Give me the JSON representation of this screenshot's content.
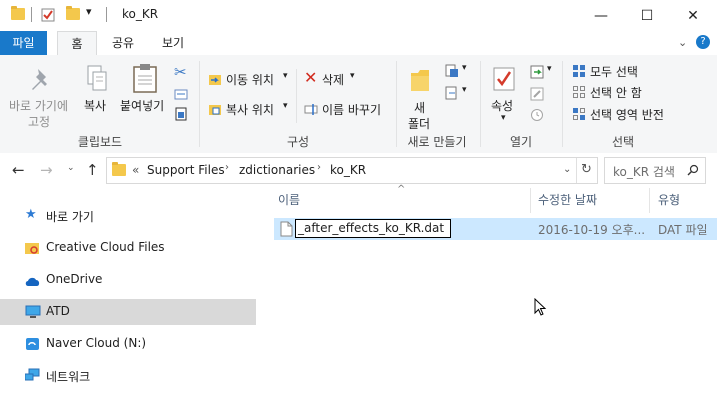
{
  "window": {
    "title": "ko_KR",
    "controls": {
      "minimize": "—",
      "maximize": "☐",
      "close": "✕"
    }
  },
  "ribbon_tabs": {
    "file": "파일",
    "home": "홈",
    "share": "공유",
    "view": "보기"
  },
  "ribbon": {
    "clipboard": {
      "pin_line1": "바로 가기에",
      "pin_line2": "고정",
      "copy": "복사",
      "paste": "붙여넣기",
      "group_label": "클립보드"
    },
    "organize": {
      "move_to": "이동 위치",
      "copy_to": "복사 위치",
      "delete": "삭제",
      "rename": "이름 바꾸기",
      "group_label": "구성"
    },
    "new": {
      "new_folder_line1": "새",
      "new_folder_line2": "폴더",
      "group_label": "새로 만들기"
    },
    "open": {
      "properties": "속성",
      "group_label": "열기"
    },
    "select": {
      "select_all": "모두 선택",
      "select_none": "선택 안 함",
      "invert": "선택 영역 반전",
      "group_label": "선택"
    }
  },
  "address": {
    "overflow": "«",
    "breadcrumbs": [
      "Support Files",
      "zdictionaries",
      "ko_KR"
    ],
    "search_placeholder": "ko_KR 검색"
  },
  "nav_pane": {
    "items": [
      {
        "label": "바로 가기"
      },
      {
        "label": "Creative Cloud Files"
      },
      {
        "label": "OneDrive"
      },
      {
        "label": "ATD"
      },
      {
        "label": "Naver Cloud (N:)"
      },
      {
        "label": "네트워크"
      }
    ]
  },
  "file_list": {
    "columns": {
      "name": "이름",
      "modified": "수정한 날짜",
      "type": "유형"
    },
    "rows": [
      {
        "name": "_after_effects_ko_KR.dat",
        "modified": "2016-10-19 오후...",
        "type": "DAT 파일"
      }
    ]
  },
  "colors": {
    "accent": "#1979ca",
    "selection": "#cce8ff",
    "nav_selected": "#d9d9d9"
  }
}
